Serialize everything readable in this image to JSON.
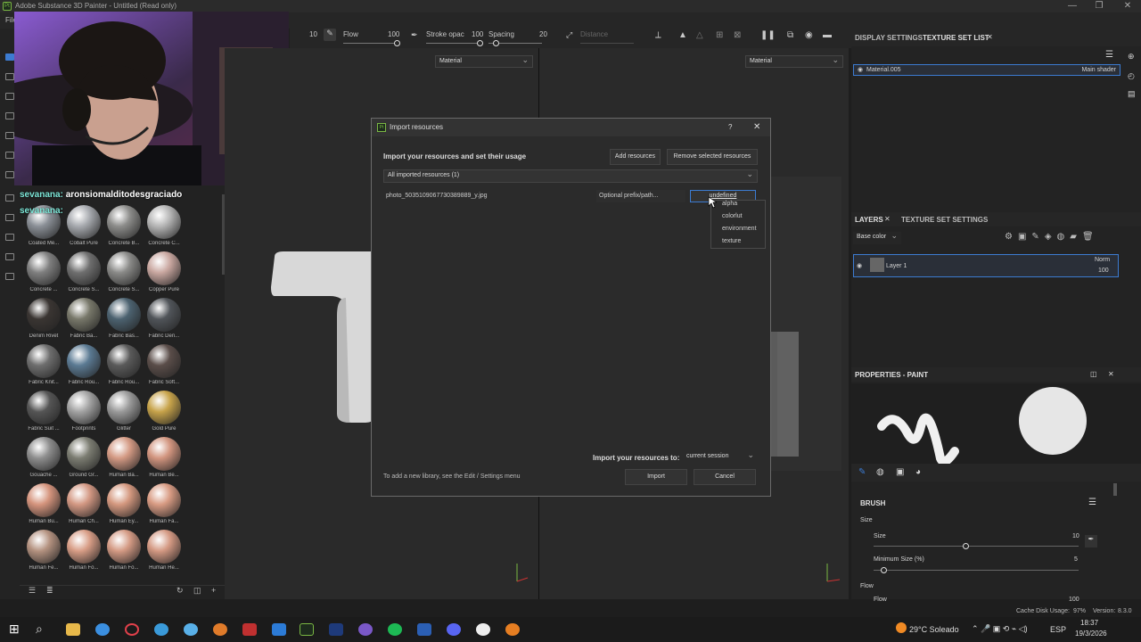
{
  "window": {
    "title": "Adobe Substance 3D Painter - Untitled (Read only)",
    "app_icon": "Pt",
    "minimize": "—",
    "maximize": "❐",
    "close": "✕",
    "menu_first": "File"
  },
  "toolbar": {
    "size_value": "10",
    "flow_label": "Flow",
    "flow_value": "100",
    "stroke_label": "Stroke opac",
    "stroke_value": "100",
    "spacing_label": "Spacing",
    "spacing_value": "20",
    "distance_label": "Distance"
  },
  "viewport": {
    "left_channel": "Material",
    "right_channel": "Material"
  },
  "chat": {
    "line1_user": "sevanana:",
    "line1_text": "aronsiomalditodesgraciado",
    "line2_user": "sevanana:"
  },
  "shelf": {
    "materials": [
      {
        "label": "Coated Me...",
        "color": "#8a8f96"
      },
      {
        "label": "Cobalt Pure",
        "color": "#a6a9ae"
      },
      {
        "label": "Concrete B...",
        "color": "#8c8c8a"
      },
      {
        "label": "Concrete C...",
        "color": "#b5b5b5"
      },
      {
        "label": "Concrete ...",
        "color": "#7f7f7f"
      },
      {
        "label": "Concrete S...",
        "color": "#6f6f6f"
      },
      {
        "label": "Concrete S...",
        "color": "#8a8a88"
      },
      {
        "label": "Copper Pure",
        "color": "#c9a7a0"
      },
      {
        "label": "Denim Rivet",
        "color": "#3a3532"
      },
      {
        "label": "Fabric Ba...",
        "color": "#78786a"
      },
      {
        "label": "Fabric Bas...",
        "color": "#4c6270"
      },
      {
        "label": "Fabric Den...",
        "color": "#505459"
      },
      {
        "label": "Fabric Knit...",
        "color": "#6e6e6e"
      },
      {
        "label": "Fabric Rou...",
        "color": "#5b7a93"
      },
      {
        "label": "Fabric Rou...",
        "color": "#5a5a5a"
      },
      {
        "label": "Fabric Soft...",
        "color": "#5a4d49"
      },
      {
        "label": "Fabric Suit ...",
        "color": "#555"
      },
      {
        "label": "Footprints",
        "color": "#a3a3a3"
      },
      {
        "label": "Glitter",
        "color": "#9a9a9a"
      },
      {
        "label": "Gold Pure",
        "color": "#c7a34a"
      },
      {
        "label": "Gouache ...",
        "color": "#8e8e8e"
      },
      {
        "label": "Ground Gr...",
        "color": "#7c7d72"
      },
      {
        "label": "Human Ba...",
        "color": "#d49a84"
      },
      {
        "label": "Human Be...",
        "color": "#d2957f"
      },
      {
        "label": "Human Bu...",
        "color": "#d5947d"
      },
      {
        "label": "Human Ch...",
        "color": "#d39883"
      },
      {
        "label": "Human Ey...",
        "color": "#d4987f"
      },
      {
        "label": "Human Fa...",
        "color": "#d89b83"
      },
      {
        "label": "Human Fe...",
        "color": "#b49280"
      },
      {
        "label": "Human Fo...",
        "color": "#d89d86"
      },
      {
        "label": "Human Fo...",
        "color": "#d49a84"
      },
      {
        "label": "Human He...",
        "color": "#d49983"
      }
    ]
  },
  "dialog": {
    "icon": "Pt",
    "title": "Import resources",
    "help": "?",
    "close": "✕",
    "heading": "Import your resources and set their usage",
    "add_button": "Add resources",
    "remove_button": "Remove selected resources",
    "filter": "All imported resources (1)",
    "file_name": "photo_5035109067730389889_y.jpg",
    "prefix_placeholder": "Optional prefix/path...",
    "usage_value": "undefined",
    "usage_options": [
      "alpha",
      "colorlut",
      "environment",
      "texture"
    ],
    "import_to_label": "Import your resources to:",
    "import_to_value": "current session",
    "footer_note": "To add a new library, see the Edit / Settings menu",
    "import_button": "Import",
    "cancel_button": "Cancel"
  },
  "right_panel": {
    "tab_display": "DISPLAY SETTINGS",
    "tab_texture_set": "TEXTURE SET LIST",
    "material_name": "Material.005",
    "material_shader": "Main shader",
    "tab_layers": "LAYERS",
    "tab_texture_settings": "TEXTURE SET SETTINGS",
    "channel": "Base color",
    "layer_name": "Layer 1",
    "blend": "Norm",
    "opacity": "100",
    "properties_title": "PROPERTIES - PAINT",
    "brush_header": "BRUSH",
    "size_label": "Size",
    "size_sub": "Size",
    "size_value": "10",
    "size_fraction": 0.45,
    "min_size_label": "Minimum Size (%)",
    "min_size_value": "5",
    "min_size_fraction": 0.05,
    "flow_label": "Flow",
    "flow_sub": "Flow",
    "flow_value": "100"
  },
  "status": {
    "cache": "Cache Disk Usage:",
    "cache_value": "97%",
    "version_label": "Version:",
    "version": "8.3.0"
  },
  "taskbar": {
    "weather": "29°C Soleado",
    "lang": "ESP",
    "time": "18:37",
    "date": "19/3/2026"
  },
  "colors": {
    "accent": "#3c7bd1",
    "pt_green": "#7ab843"
  }
}
